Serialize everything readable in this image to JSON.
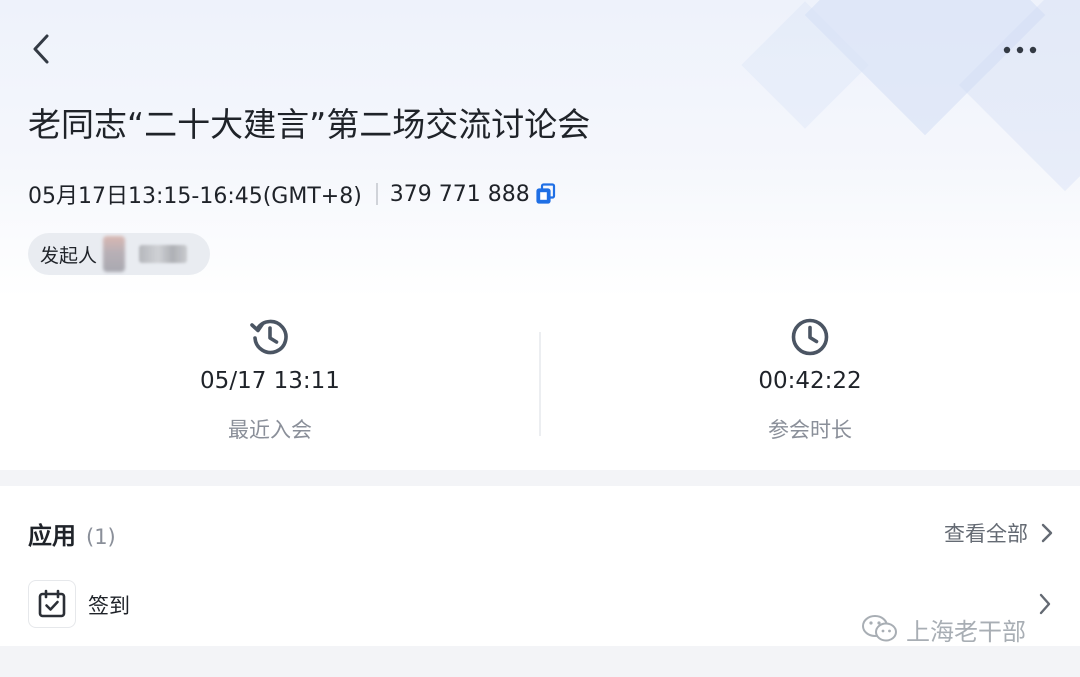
{
  "meeting": {
    "title": "老同志“二十大建言”第二场交流讨论会",
    "time": "05月17日13:15-16:45(GMT+8)",
    "meeting_id": "379 771 888",
    "host_label": "发起人"
  },
  "stats": [
    {
      "icon": "history-clock-icon",
      "value": "05/17 13:11",
      "label": "最近入会"
    },
    {
      "icon": "clock-icon",
      "value": "00:42:22",
      "label": "参会时长"
    }
  ],
  "apps": {
    "title": "应用",
    "count": "(1)",
    "view_all": "查看全部",
    "items": [
      {
        "icon": "calendar-check-icon",
        "label": "签到"
      }
    ]
  },
  "watermark": {
    "text": "上海老干部",
    "icon": "wechat-icon"
  },
  "colors": {
    "accent": "#1f6fe5",
    "text_primary": "#1f2329",
    "text_secondary": "#8a8f99",
    "icon_gray": "#4b5563"
  }
}
